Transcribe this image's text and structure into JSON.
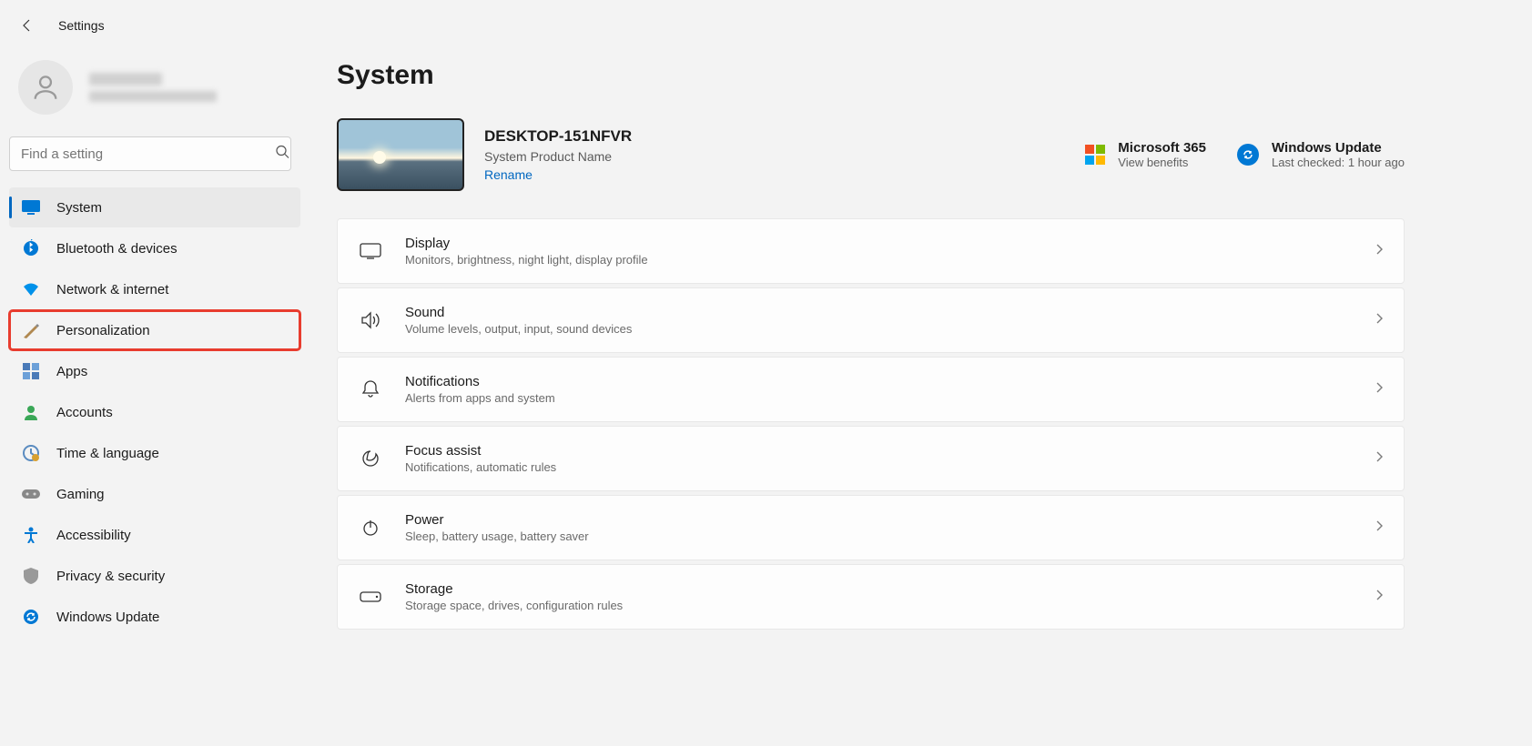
{
  "header": {
    "title": "Settings"
  },
  "search": {
    "placeholder": "Find a setting"
  },
  "nav": {
    "system": "System",
    "bluetooth": "Bluetooth & devices",
    "network": "Network & internet",
    "personalization": "Personalization",
    "apps": "Apps",
    "accounts": "Accounts",
    "time": "Time & language",
    "gaming": "Gaming",
    "accessibility": "Accessibility",
    "privacy": "Privacy & security",
    "update": "Windows Update"
  },
  "page": {
    "title": "System"
  },
  "device": {
    "name": "DESKTOP-151NFVR",
    "product": "System Product Name",
    "rename": "Rename"
  },
  "ms365": {
    "title": "Microsoft 365",
    "sub": "View benefits"
  },
  "winupdate": {
    "title": "Windows Update",
    "sub": "Last checked: 1 hour ago"
  },
  "settings": {
    "display": {
      "title": "Display",
      "desc": "Monitors, brightness, night light, display profile"
    },
    "sound": {
      "title": "Sound",
      "desc": "Volume levels, output, input, sound devices"
    },
    "notifications": {
      "title": "Notifications",
      "desc": "Alerts from apps and system"
    },
    "focus": {
      "title": "Focus assist",
      "desc": "Notifications, automatic rules"
    },
    "power": {
      "title": "Power",
      "desc": "Sleep, battery usage, battery saver"
    },
    "storage": {
      "title": "Storage",
      "desc": "Storage space, drives, configuration rules"
    }
  }
}
